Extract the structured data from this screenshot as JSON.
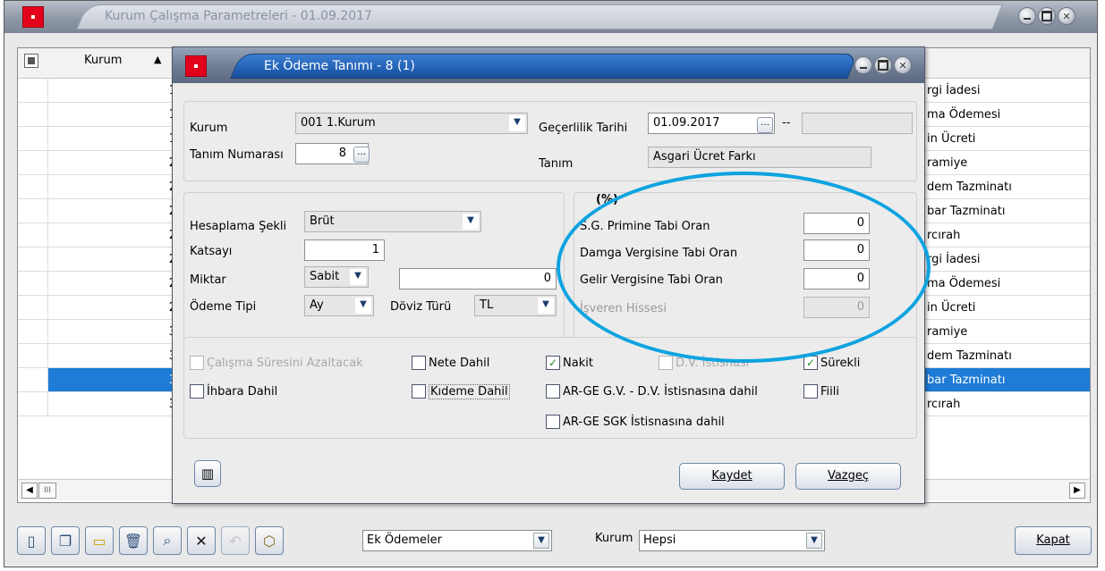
{
  "outer_window": {
    "title": "Kurum Çalışma Parametreleri - 01.09.2017"
  },
  "grid": {
    "column_kurum": "Kurum",
    "scroll_thumb": "III",
    "rows": [
      {
        "kurum": "1",
        "name": "rgi İadesi"
      },
      {
        "kurum": "1",
        "name": "ma Ödemesi"
      },
      {
        "kurum": "1",
        "name": "in Ücreti"
      },
      {
        "kurum": "2",
        "name": "ramiye"
      },
      {
        "kurum": "2",
        "name": "dem Tazminatı"
      },
      {
        "kurum": "2",
        "name": "bar Tazminatı"
      },
      {
        "kurum": "2",
        "name": "rcırah"
      },
      {
        "kurum": "2",
        "name": "rgi İadesi"
      },
      {
        "kurum": "2",
        "name": "ma Ödemesi"
      },
      {
        "kurum": "2",
        "name": "in Ücreti"
      },
      {
        "kurum": "3",
        "name": "ramiye"
      },
      {
        "kurum": "3",
        "name": "dem Tazminatı"
      },
      {
        "kurum": "3",
        "name": "bar Tazminatı"
      },
      {
        "kurum": "3",
        "name": "rcırah"
      }
    ]
  },
  "toolbar": {
    "filter_value": "Ek Ödemeler",
    "kurum_label": "Kurum",
    "kurum_value": "Hepsi",
    "close_label": "Kapat"
  },
  "dialog": {
    "title": "Ek Ödeme Tanımı - 8 (1)",
    "kurum_label": "Kurum",
    "kurum_value": "001 1.Kurum",
    "gecerlilik_label": "Geçerlilik Tarihi",
    "gecerlilik_value": "01.09.2017",
    "date_separator": "--",
    "tanim_no_label": "Tanım Numarası",
    "tanim_no_value": "8",
    "tanim_label": "Tanım",
    "tanim_value": "Asgari Ücret Farkı",
    "hesaplama_label": "Hesaplama Şekli",
    "hesaplama_value": "Brüt",
    "katsayi_label": "Katsayı",
    "katsayi_value": "1",
    "miktar_label": "Miktar",
    "miktar_type": "Sabit",
    "miktar_value": "0",
    "odeme_tipi_label": "Ödeme Tipi",
    "odeme_tipi_value": "Ay",
    "doviz_label": "Döviz Türü",
    "doviz_value": "TL",
    "percent_header": "(%)",
    "sg_label": "S.G. Primine Tabi Oran",
    "sg_value": "0",
    "damga_label": "Damga Vergisine Tabi Oran",
    "damga_value": "0",
    "gelir_label": "Gelir Vergisine Tabi Oran",
    "gelir_value": "0",
    "isveren_label": "İşveren Hissesi",
    "isveren_value": "0",
    "checkboxes": {
      "calisma": "Çalışma Süresini Azaltacak",
      "nete": "Nete Dahil",
      "nakit": "Nakit",
      "dv_istisnasi": "D.V. İstisnası",
      "surekli": "Sürekli",
      "ihbara": "İhbara Dahil",
      "kideme": "Kıdeme Dahil",
      "arge_gv": "AR-GE G.V. - D.V. İstisnasına dahil",
      "fiili": "Fiili",
      "arge_sgk": "AR-GE SGK İstisnasına dahil"
    },
    "save_label": "Kaydet",
    "cancel_label": "Vazgeç"
  },
  "colors": {
    "selection": "#1e7bd6",
    "annotation_ellipse": "#0ea3e0",
    "dialog_title": "#1f5db1"
  }
}
